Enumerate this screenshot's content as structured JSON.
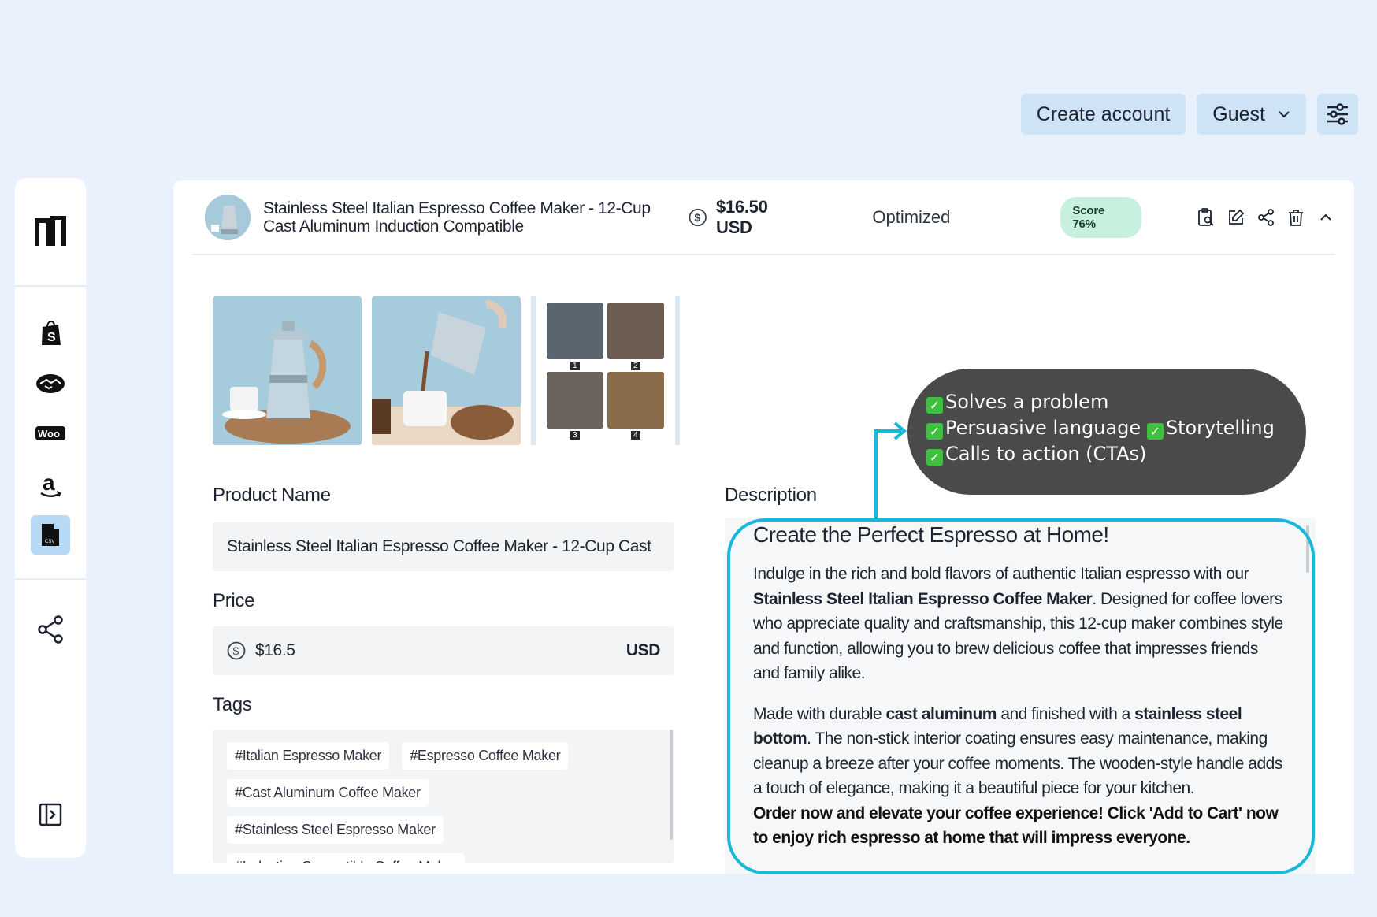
{
  "topbar": {
    "create_account": "Create account",
    "guest_label": "Guest"
  },
  "product": {
    "title": "Stainless Steel Italian Espresso Coffee Maker - 12-Cup Cast Aluminum Induction Compatible",
    "price_display": "$16.50 USD",
    "status": "Optimized",
    "score": "Score 76%"
  },
  "gallery": {
    "grid_numbers": [
      "1",
      "2",
      "3",
      "4"
    ]
  },
  "form": {
    "name_label": "Product Name",
    "name_value": "Stainless Steel Italian Espresso Coffee Maker - 12-Cup Cast",
    "price_label": "Price",
    "price_value": "$16.5",
    "currency": "USD",
    "tags_label": "Tags",
    "tags": [
      "#Italian Espresso Maker",
      "#Espresso Coffee Maker",
      "#Cast Aluminum Coffee Maker",
      "#Stainless Steel Espresso Maker",
      "#Induction Compatible Coffee Maker"
    ]
  },
  "description": {
    "label": "Description",
    "heading": "Create the Perfect Espresso at Home!",
    "p1_a": "Indulge in the rich and bold flavors of authentic Italian espresso with our ",
    "p1_b": "Stainless Steel Italian Espresso Coffee Maker",
    "p1_c": ". Designed for coffee lovers who appreciate quality and craftsmanship, this 12-cup maker combines style and function, allowing you to brew delicious coffee that impresses friends and family alike.",
    "p2_a": "Made with durable ",
    "p2_b": "cast aluminum",
    "p2_c": " and finished with a ",
    "p2_d": "stainless steel bottom",
    "p2_e": ". The non-stick interior coating ensures easy maintenance, making cleanup a breeze after your coffee moments. The wooden-style handle adds a touch of elegance, making it a beautiful piece for your kitchen.",
    "cta": "Order now and elevate your coffee experience! Click 'Add to Cart' now to enjoy rich espresso at home that will impress everyone."
  },
  "callout": {
    "item1": "Solves a problem",
    "item2": "Persuasive language",
    "item3": "Storytelling",
    "item4": "Calls to action (CTAs)"
  },
  "colors": {
    "accent_ring": "#18b8d8",
    "score_bg": "#c7f0de",
    "page_bg": "#e9f2fc"
  }
}
